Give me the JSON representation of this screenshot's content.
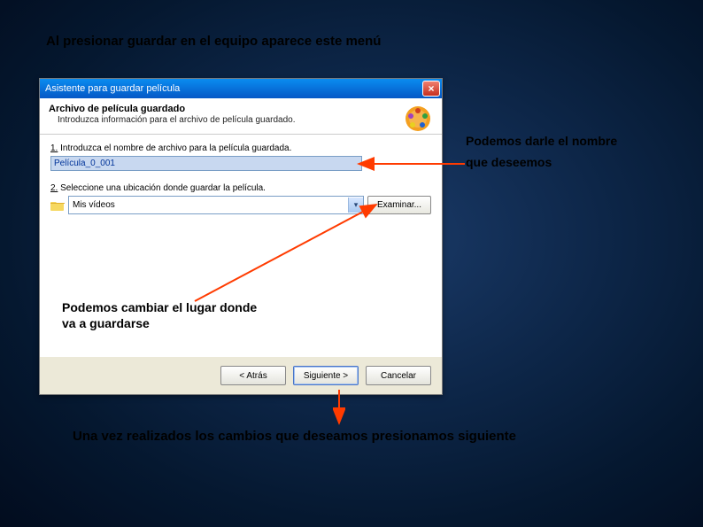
{
  "slide": {
    "title": "Al presionar guardar en el equipo aparece este menú",
    "annot_name_line1": "Podemos darle el nombre",
    "annot_name_line2": "que deseemos",
    "annot_location": "Podemos cambiar el lugar donde\nva a guardarse",
    "annot_next": "Una vez realizados los cambios que deseamos presionamos siguiente"
  },
  "dialog": {
    "title": "Asistente para guardar película",
    "header_title": "Archivo de película guardado",
    "header_sub": "Introduzca información para el archivo de película guardado.",
    "label_filename_prefix": "1.",
    "label_filename": "Introduzca el nombre de archivo para la película guardada.",
    "filename_value": "Película_0_001",
    "label_location_prefix": "2.",
    "label_location": "Seleccione una ubicación donde guardar la película.",
    "location_value": "Mis vídeos",
    "browse": "Examinar...",
    "btn_back": "< Atrás",
    "btn_next": "Siguiente >",
    "btn_cancel": "Cancelar"
  }
}
